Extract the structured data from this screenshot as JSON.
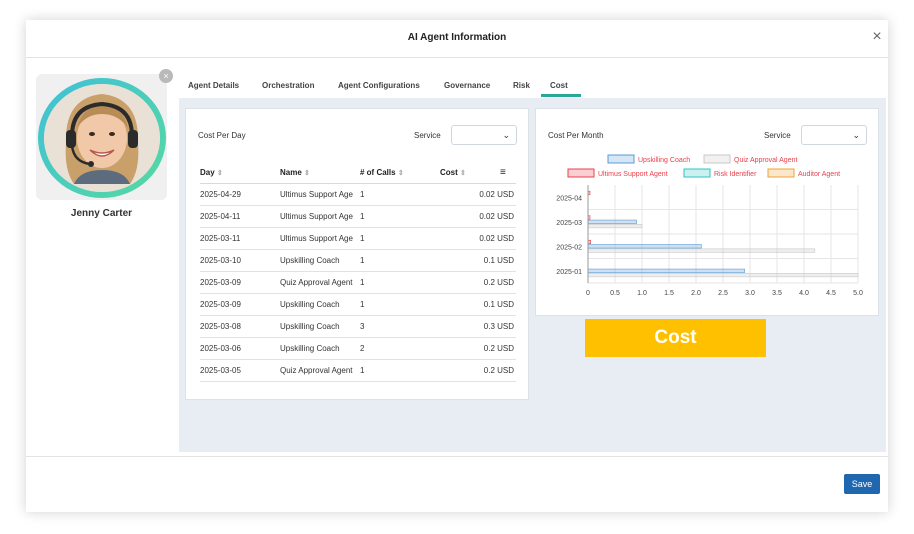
{
  "modal": {
    "title": "AI Agent Information",
    "close_icon": "×",
    "save_label": "Save"
  },
  "profile": {
    "name": "Jenny Carter",
    "remove_icon": "×"
  },
  "tabs": [
    "Agent Details",
    "Orchestration",
    "Agent Configurations",
    "Governance",
    "Risk",
    "Cost"
  ],
  "active_tab": "Cost",
  "cost_per_day": {
    "title": "Cost Per Day",
    "service_label": "Service",
    "service_value": "",
    "columns": [
      "Day",
      "Name",
      "# of Calls",
      "Cost"
    ],
    "rows": [
      [
        "2025-04-29",
        "Ultimus Support Age",
        "1",
        "0.02 USD"
      ],
      [
        "2025-04-11",
        "Ultimus Support Age",
        "1",
        "0.02 USD"
      ],
      [
        "2025-03-11",
        "Ultimus Support Age",
        "1",
        "0.02 USD"
      ],
      [
        "2025-03-10",
        "Upskilling Coach",
        "1",
        "0.1 USD"
      ],
      [
        "2025-03-09",
        "Quiz Approval Agent",
        "1",
        "0.2 USD"
      ],
      [
        "2025-03-09",
        "Upskilling Coach",
        "1",
        "0.1 USD"
      ],
      [
        "2025-03-08",
        "Upskilling Coach",
        "3",
        "0.3 USD"
      ],
      [
        "2025-03-06",
        "Upskilling Coach",
        "2",
        "0.2 USD"
      ],
      [
        "2025-03-05",
        "Quiz Approval Agent",
        "1",
        "0.2 USD"
      ]
    ]
  },
  "cost_per_month": {
    "title": "Cost Per Month",
    "service_label": "Service",
    "service_value": ""
  },
  "banner": {
    "text": "Cost"
  },
  "colors": {
    "accent": "#2aa79b",
    "save": "#1f68b0",
    "banner": "#ffc000"
  },
  "chart_data": {
    "type": "bar",
    "orientation": "horizontal",
    "categories": [
      "2025-04",
      "2025-03",
      "2025-02",
      "2025-01"
    ],
    "series": [
      {
        "name": "Upskilling Coach",
        "color": "#5b9bd5",
        "values": [
          0,
          0.9,
          2.1,
          2.9
        ]
      },
      {
        "name": "Quiz Approval Agent",
        "color": "#c8c8c8",
        "values": [
          0,
          1.0,
          4.2,
          5.0
        ]
      },
      {
        "name": "Ultimus Support Agent",
        "color": "#e8414b",
        "values": [
          0.02,
          0.02,
          0.05,
          0
        ]
      },
      {
        "name": "Risk Identifier",
        "color": "#2ec4c4",
        "values": [
          0,
          0,
          0,
          0
        ]
      },
      {
        "name": "Auditor Agent",
        "color": "#f0a030",
        "values": [
          0,
          0,
          0,
          0
        ]
      }
    ],
    "xticks": [
      "0",
      "0.5",
      "1.0",
      "1.5",
      "2.0",
      "2.5",
      "3.0",
      "3.5",
      "4.0",
      "4.5",
      "5.0"
    ],
    "xlim": [
      0,
      5
    ],
    "grid": true,
    "legend_position": "top"
  }
}
